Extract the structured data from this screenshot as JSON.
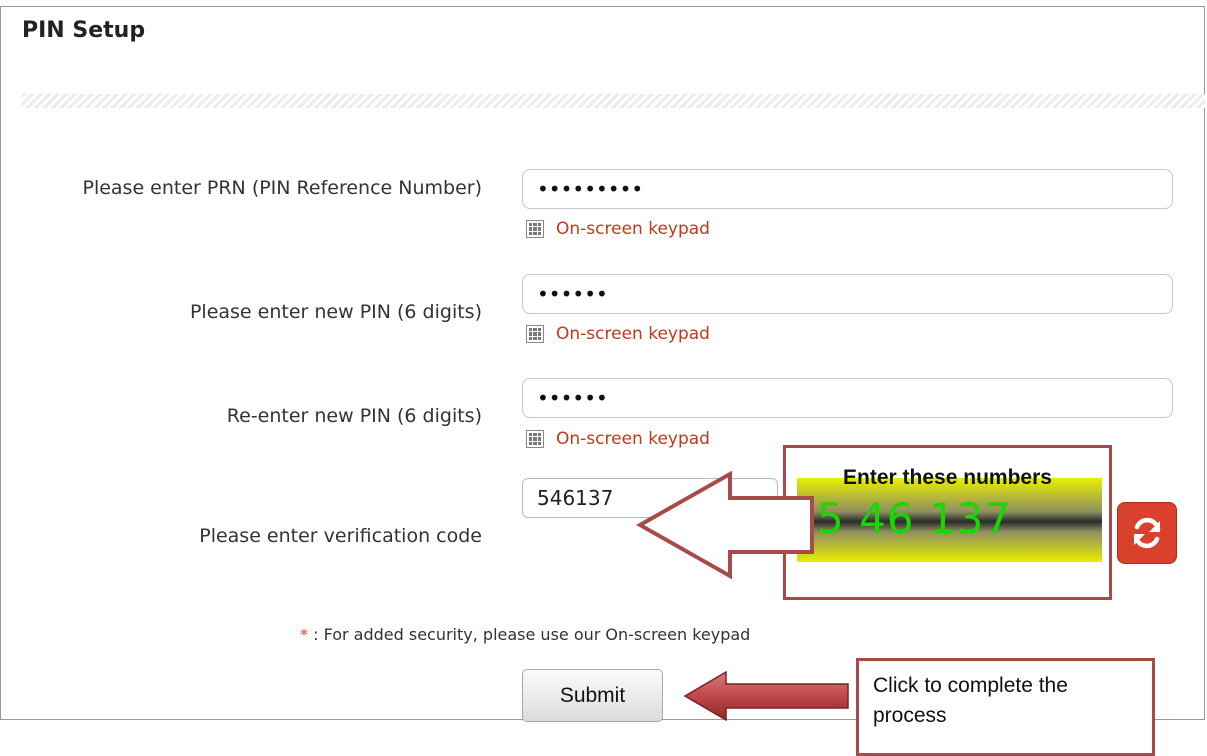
{
  "page": {
    "title": "PIN Setup"
  },
  "form": {
    "fields": [
      {
        "label": "Please enter PRN (PIN Reference Number)",
        "value": "•••••••••",
        "keypad": "On-screen keypad"
      },
      {
        "label": "Please enter new PIN (6 digits)",
        "value": "••••••",
        "keypad": "On-screen keypad"
      },
      {
        "label": "Re-enter new PIN (6 digits)",
        "value": "••••••",
        "keypad": "On-screen keypad"
      }
    ],
    "verification": {
      "label": "Please enter verification code",
      "value": "546137",
      "captcha_text": "5 46 137"
    },
    "note": {
      "star": "*",
      "text": " : For added security, please use our On-screen keypad"
    },
    "submit_label": "Submit"
  },
  "annotations": {
    "captcha_callout": "Enter these numbers",
    "submit_callout": "Click to complete the process"
  },
  "colors": {
    "keypad_link": "#c0391b",
    "callout_border": "#a94a4a",
    "arrow_fill": "#c75050",
    "captcha_digits": "#17d800",
    "refresh_button": "#d9412c"
  },
  "icons": [
    "keypad-icon",
    "refresh-icon",
    "left-arrow-icon"
  ]
}
